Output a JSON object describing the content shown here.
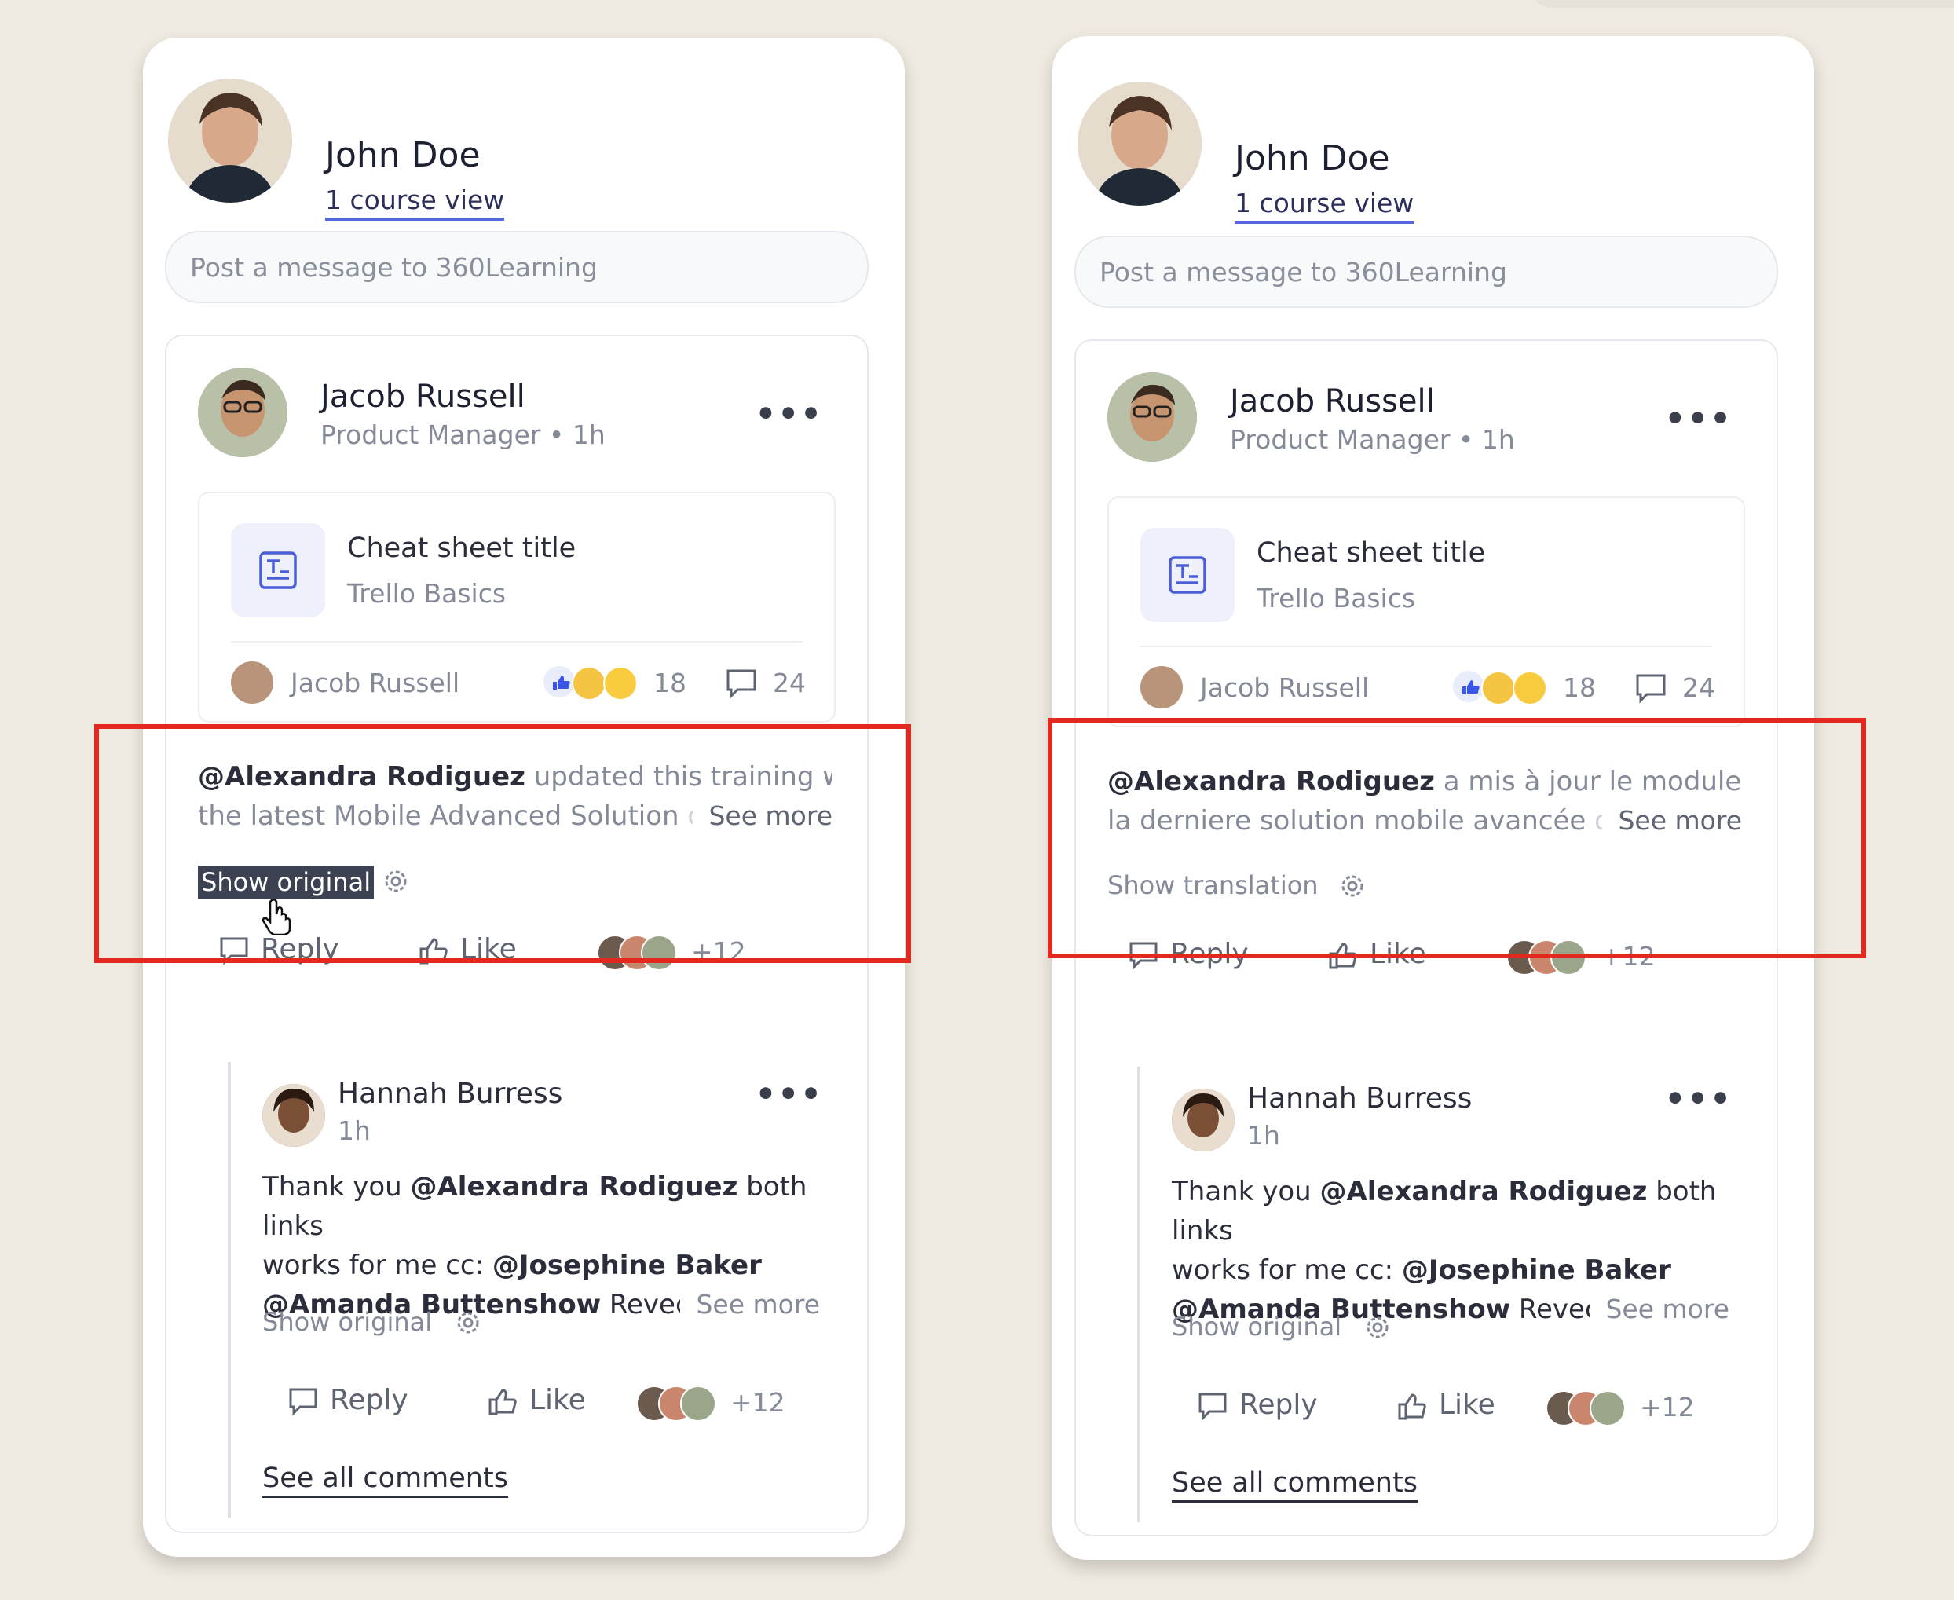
{
  "panels": [
    {
      "header": {
        "name": "John Doe",
        "sub": "1 course view"
      },
      "composer": {
        "placeholder": "Post a message to 360Learning"
      },
      "post": {
        "author": "Jacob Russell",
        "role": "Product Manager • 1h",
        "card": {
          "title": "Cheat sheet title",
          "subtitle": "Trello Basics",
          "footer_name": "Jacob Russell",
          "reactions": "18",
          "comments": "24"
        },
        "message": {
          "mention": "@Alexandra Rodiguez",
          "line1": " updated this training with",
          "line2": "the latest Mobile Advanced Solution",
          "line2_fade": " d",
          "see_more": "See more"
        },
        "toggle": "Show original",
        "actions": {
          "reply": "Reply",
          "like": "Like",
          "plus": "+12"
        }
      },
      "reply": {
        "author": "Hannah Burress",
        "time": "1h",
        "line1_a": "Thank you ",
        "line1_mention": "@Alexandra Rodiguez",
        "line1_b": " both links",
        "line2_a": "works for me cc: ",
        "line2_mention": "@Josephine Baker",
        "line3_mention": "@Amanda Buttenshow",
        "line3_b": " Revecc",
        "line3_fade": "a",
        "see_more": "See more",
        "toggle": "Show original",
        "actions": {
          "reply": "Reply",
          "like": "Like",
          "plus": "+12"
        }
      },
      "see_all": "See all comments"
    },
    {
      "header": {
        "name": "John Doe",
        "sub": "1 course view"
      },
      "composer": {
        "placeholder": "Post a message to 360Learning"
      },
      "post": {
        "author": "Jacob Russell",
        "role": "Product Manager • 1h",
        "card": {
          "title": "Cheat sheet title",
          "subtitle": "Trello Basics",
          "footer_name": "Jacob Russell",
          "reactions": "18",
          "comments": "24"
        },
        "message": {
          "mention": "@Alexandra Rodiguez",
          "line1": " a mis à jour le module avec",
          "line2": "la derniere solution mobile avancée",
          "line2_fade": " o",
          "see_more": "See more"
        },
        "toggle": "Show translation",
        "actions": {
          "reply": "Reply",
          "like": "Like",
          "plus": "+12"
        }
      },
      "reply": {
        "author": "Hannah Burress",
        "time": "1h",
        "line1_a": "Thank you ",
        "line1_mention": "@Alexandra Rodiguez",
        "line1_b": " both links",
        "line2_a": "works for me cc: ",
        "line2_mention": "@Josephine Baker",
        "line3_mention": "@Amanda Buttenshow",
        "line3_b": " Revecc",
        "line3_fade": "a",
        "see_more": "See more",
        "toggle": "Show original",
        "actions": {
          "reply": "Reply",
          "like": "Like",
          "plus": "+12"
        }
      },
      "see_all": "See all comments"
    }
  ],
  "colors": {
    "highlight_border": "#e3281f",
    "link_underline": "#5568e0",
    "background": "#efebe1"
  },
  "icons": [
    "user-avatar",
    "document-icon",
    "ellipsis-icon",
    "thumbs-up-icon",
    "emoji-icon",
    "comment-icon",
    "gear-icon",
    "hand-cursor-icon"
  ]
}
